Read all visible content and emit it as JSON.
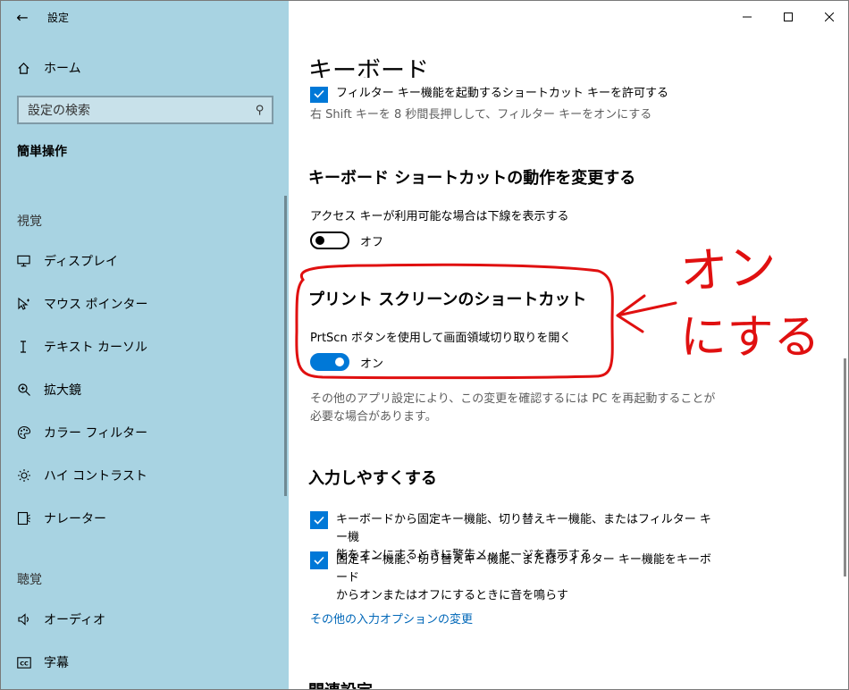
{
  "app": {
    "title": "設定"
  },
  "sidebar": {
    "home_label": "ホーム",
    "search_placeholder": "設定の検索",
    "section_title": "簡単操作",
    "groups": [
      {
        "label": "視覚"
      },
      {
        "label": "聴覚"
      }
    ],
    "items": [
      {
        "label": "ディスプレイ",
        "icon": "monitor-icon"
      },
      {
        "label": "マウス ポインター",
        "icon": "mouse-pointer-icon"
      },
      {
        "label": "テキスト カーソル",
        "icon": "text-cursor-icon"
      },
      {
        "label": "拡大鏡",
        "icon": "magnifier-icon"
      },
      {
        "label": "カラー フィルター",
        "icon": "palette-icon"
      },
      {
        "label": "ハイ コントラスト",
        "icon": "brightness-icon"
      },
      {
        "label": "ナレーター",
        "icon": "narrator-icon"
      },
      {
        "label": "オーディオ",
        "icon": "speaker-icon"
      },
      {
        "label": "字幕",
        "icon": "captions-icon"
      }
    ]
  },
  "main": {
    "page_title": "キーボード",
    "filter_keys": {
      "checkbox_label": "フィルター キー機能を起動するショートカット キーを許可する",
      "description": "右 Shift キーを 8 秒間長押しして、フィルター キーをオンにする"
    },
    "shortcut_section": {
      "title": "キーボード ショートカットの動作を変更する",
      "access_key_label": "アクセス キーが利用可能な場合は下線を表示する",
      "access_key_state": "オフ"
    },
    "print_screen": {
      "title": "プリント スクリーンのショートカット",
      "label": "PrtScn ボタンを使用して画面領域切り取りを開く",
      "state": "オン",
      "note_line1": "その他のアプリ設定により、この変更を確認するには PC を再起動することが",
      "note_line2": "必要な場合があります。"
    },
    "ease_section": {
      "title": "入力しやすくする",
      "checkbox1_line1": "キーボードから固定キー機能、切り替えキー機能、またはフィルター キー機",
      "checkbox1_line2": "能をオンにするときに警告メッセージを表示する",
      "checkbox2_line1": "固定キー機能、切り替えキー機能、またはフィルター キー機能をキーボード",
      "checkbox2_line2": "からオンまたはオフにするときに音を鳴らす",
      "link": "その他の入力オプションの変更"
    },
    "related_title": "関連設定"
  },
  "annotation": {
    "line1": "オン",
    "line2": "にする",
    "color": "#e01010"
  },
  "colors": {
    "sidebar_bg": "#a8d3e2",
    "accent": "#0078d7",
    "link": "#0067b8"
  }
}
